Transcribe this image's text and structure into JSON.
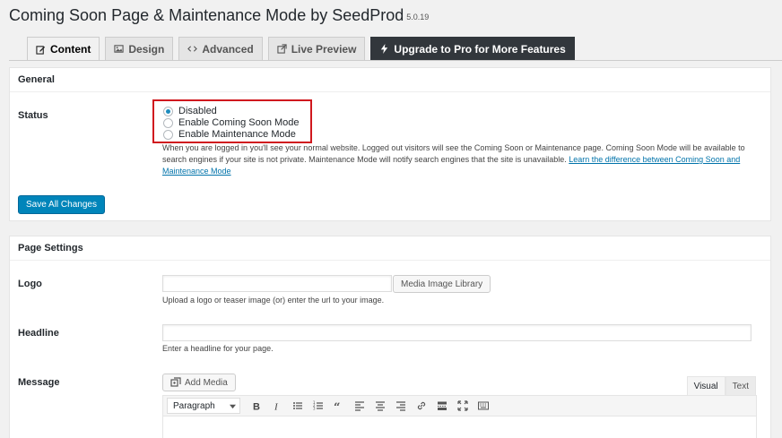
{
  "page": {
    "title": "Coming Soon Page & Maintenance Mode by SeedProd",
    "version": "5.0.19"
  },
  "tabs": [
    {
      "label": "Content",
      "icon": "edit-icon",
      "active": true
    },
    {
      "label": "Design",
      "icon": "image-icon"
    },
    {
      "label": "Advanced",
      "icon": "code-icon"
    },
    {
      "label": "Live Preview",
      "icon": "external-link-icon"
    },
    {
      "label": "Upgrade to Pro for More Features",
      "icon": "bolt-icon",
      "highlight": true
    }
  ],
  "general": {
    "title": "General",
    "status_label": "Status",
    "options": [
      {
        "label": "Disabled",
        "selected": true
      },
      {
        "label": "Enable Coming Soon Mode",
        "selected": false
      },
      {
        "label": "Enable Maintenance Mode",
        "selected": false
      }
    ],
    "description_line1": "When you are logged in you'll see your normal website. Logged out visitors will see the Coming Soon or Maintenance page. Coming Soon Mode will be available to",
    "description_line2": "search engines if your site is not private. Maintenance Mode will notify search engines that the site is unavailable. ",
    "description_link1": "Learn the difference between Coming Soon and",
    "description_link2": "Maintenance Mode",
    "save_button": "Save All Changes"
  },
  "page_settings": {
    "title": "Page Settings",
    "logo_label": "Logo",
    "logo_value": "",
    "media_button": "Media Image Library",
    "logo_help": "Upload a logo or teaser image (or) enter the url to your image.",
    "headline_label": "Headline",
    "headline_value": "",
    "headline_help": "Enter a headline for your page.",
    "message_label": "Message",
    "add_media_button": "Add Media",
    "editor_tabs": [
      "Visual",
      "Text"
    ],
    "format_select": "Paragraph"
  },
  "colors": {
    "primary": "#0085ba",
    "highlight_border": "#d0181e",
    "pro_tab": "#32373c",
    "link": "#0073aa"
  }
}
